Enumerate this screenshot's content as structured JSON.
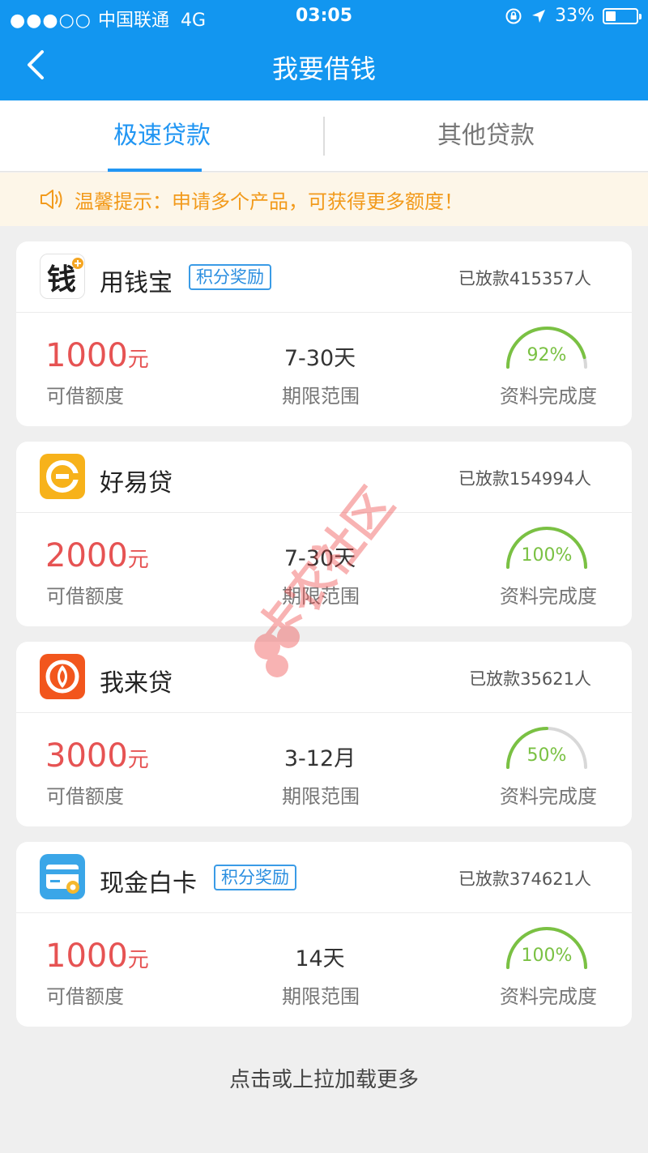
{
  "status_bar": {
    "signal": "●●●○○",
    "carrier": "中国联通",
    "network": "4G",
    "time": "03:05",
    "battery": "33%"
  },
  "nav": {
    "title": "我要借钱"
  },
  "tabs": [
    {
      "label": "极速贷款",
      "active": true
    },
    {
      "label": "其他贷款",
      "active": false
    }
  ],
  "notice": {
    "text": "温馨提示：申请多个产品，可获得更多额度！"
  },
  "labels": {
    "amount": "可借额度",
    "term": "期限范围",
    "completion": "资料完成度",
    "unit": "元"
  },
  "products": [
    {
      "name": "用钱宝",
      "badge": "积分奖励",
      "released": "已放款415357人",
      "amount": "1000",
      "unit": "元",
      "term": "7-30天",
      "completion": "92%",
      "completion_value": 0.92,
      "logo_char": "钱"
    },
    {
      "name": "好易贷",
      "badge": "",
      "released": "已放款154994人",
      "amount": "2000",
      "unit": "元",
      "term": "7-30天",
      "completion": "100%",
      "completion_value": 1.0
    },
    {
      "name": "我来贷",
      "badge": "",
      "released": "已放款35621人",
      "amount": "3000",
      "unit": "元",
      "term": "3-12月",
      "completion": "50%",
      "completion_value": 0.5
    },
    {
      "name": "现金白卡",
      "badge": "积分奖励",
      "released": "已放款374621人",
      "amount": "1000",
      "unit": "元",
      "term": "14天",
      "completion": "100%",
      "completion_value": 1.0
    }
  ],
  "footer": {
    "load_more": "点击或上拉加载更多"
  },
  "watermark": {
    "text": "卡农社区"
  },
  "colors": {
    "primary": "#1296f0",
    "tab_active": "#2196f3",
    "amount": "#e65353",
    "gauge": "#7ac143",
    "notice": "#f29a1b"
  }
}
